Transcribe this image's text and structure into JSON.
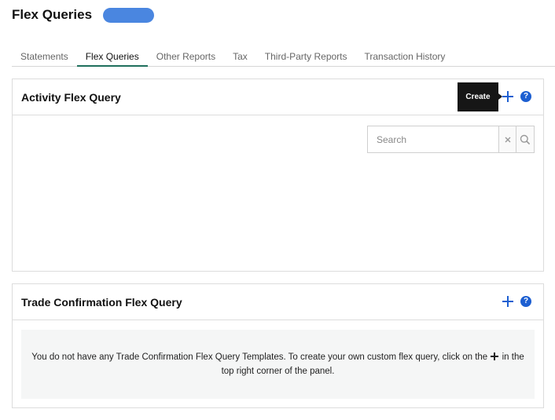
{
  "header": {
    "title": "Flex Queries"
  },
  "tabs": [
    {
      "label": "Statements",
      "active": false
    },
    {
      "label": "Flex Queries",
      "active": true
    },
    {
      "label": "Other Reports",
      "active": false
    },
    {
      "label": "Tax",
      "active": false
    },
    {
      "label": "Third-Party Reports",
      "active": false
    },
    {
      "label": "Transaction History",
      "active": false
    }
  ],
  "activity_panel": {
    "title": "Activity Flex Query",
    "tooltip": "Create",
    "help_label": "?",
    "search": {
      "placeholder": "Search",
      "value": ""
    }
  },
  "trade_panel": {
    "title": "Trade Confirmation Flex Query",
    "help_label": "?",
    "empty_message_before": "You do not have any Trade Confirmation Flex Query Templates. To create your own custom flex query, click on the",
    "empty_message_after": "in the top right corner of the panel."
  },
  "colors": {
    "accent": "#1d5fd1",
    "active_tab_underline": "#1f6f5c",
    "pill": "#4a86e0"
  },
  "icons": {
    "add": "plus-icon",
    "help": "help-icon",
    "clear": "close-icon",
    "search": "search-icon"
  }
}
